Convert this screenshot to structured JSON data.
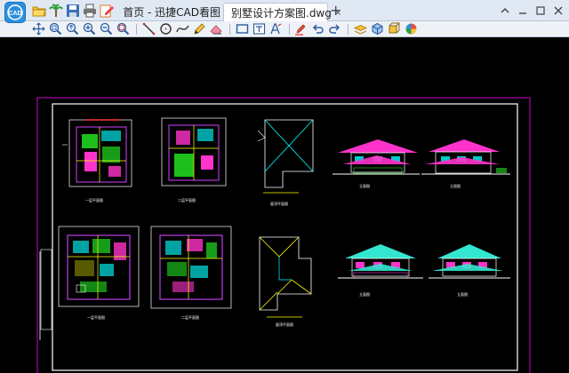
{
  "app": {
    "name": "迅捷CAD看图",
    "logo_text": "CAD"
  },
  "tabs": [
    {
      "label": "首页 - 迅捷CAD看图",
      "active": false
    },
    {
      "label": "别墅设计方案图.dwg",
      "active": true
    }
  ],
  "new_tab_symbol": "+",
  "quick_icons": [
    "open-folder-icon",
    "palm-tree-icon",
    "save-icon",
    "print-icon",
    "edit-icon"
  ],
  "window_controls": [
    "chevron-up-icon",
    "minimize-icon",
    "maximize-icon",
    "close-icon"
  ],
  "toolbar_groups": [
    [
      "pan-icon",
      "zoom-window-icon",
      "zoom-realtime-icon",
      "zoom-in-icon",
      "zoom-out-icon",
      "zoom-extents-icon"
    ],
    [
      "line-icon",
      "circle-icon",
      "spline-icon",
      "pencil-icon",
      "eraser-icon"
    ],
    [
      "rectangle-icon",
      "text-box-icon",
      "text-style-icon"
    ],
    [
      "highlighter-icon",
      "undo-icon",
      "redo-icon"
    ],
    [
      "layer-icon",
      "3d-box-icon",
      "view-cube-icon",
      "color-wheel-icon"
    ]
  ],
  "colors": {
    "tab_bar": "#dfe8f3",
    "toolbar": "#eef2f7",
    "canvas": "#000000",
    "drawing_border": "#cc00cc",
    "frame": "#ffffff",
    "roof": "#ff33cc",
    "roof_teal": "#33e6d1",
    "wall_green": "#22e022",
    "cyan": "#00ffff",
    "yellow": "#ffff00"
  },
  "drawing": {
    "labels": [
      "一层平面图",
      "二层平面图",
      "屋顶平面图",
      "立面图",
      "立面图",
      "一层平面图",
      "二层平面图",
      "屋顶平面图",
      "立面图",
      "立面图"
    ]
  }
}
